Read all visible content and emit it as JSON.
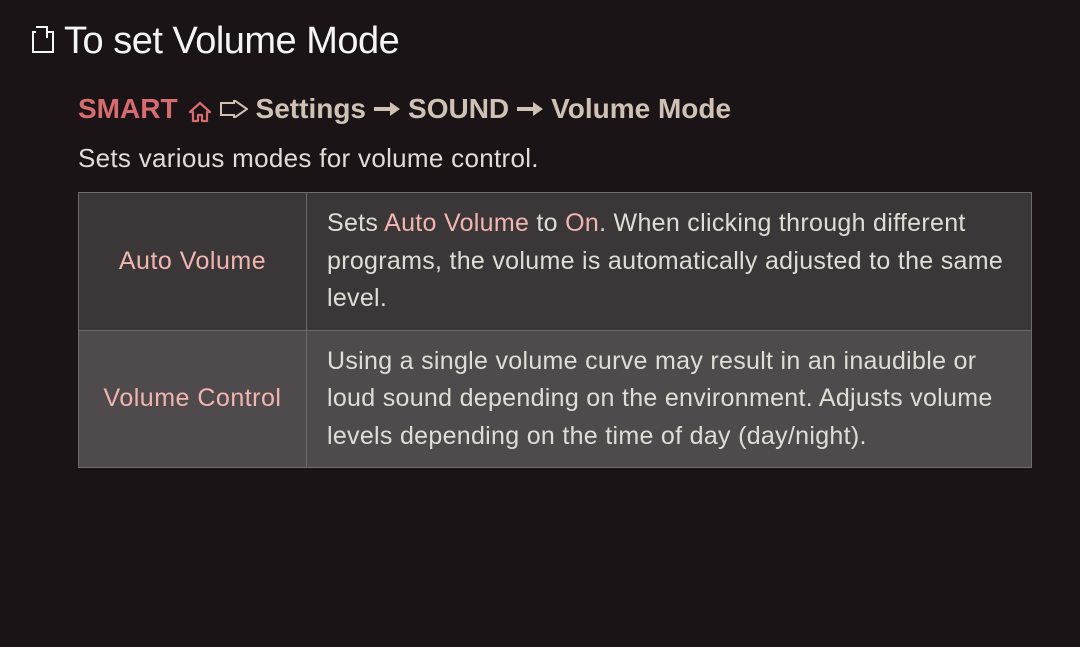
{
  "title": "To set Volume Mode",
  "breadcrumb": {
    "smart": "SMART",
    "settings": "Settings",
    "sound": "SOUND",
    "volumeMode": "Volume Mode"
  },
  "description": "Sets various modes for volume control.",
  "table": {
    "rows": [
      {
        "label": "Auto Volume",
        "prefix": "Sets ",
        "highlight1": "Auto Volume",
        "mid": " to ",
        "highlight2": "On",
        "suffix": ". When clicking through different programs, the volume is automatically adjusted to the same level."
      },
      {
        "label": "Volume Control",
        "text": "Using a single volume curve may result in an inaudible or loud sound depending on the environment. Adjusts volume levels depending on the time of day (day/night)."
      }
    ]
  }
}
